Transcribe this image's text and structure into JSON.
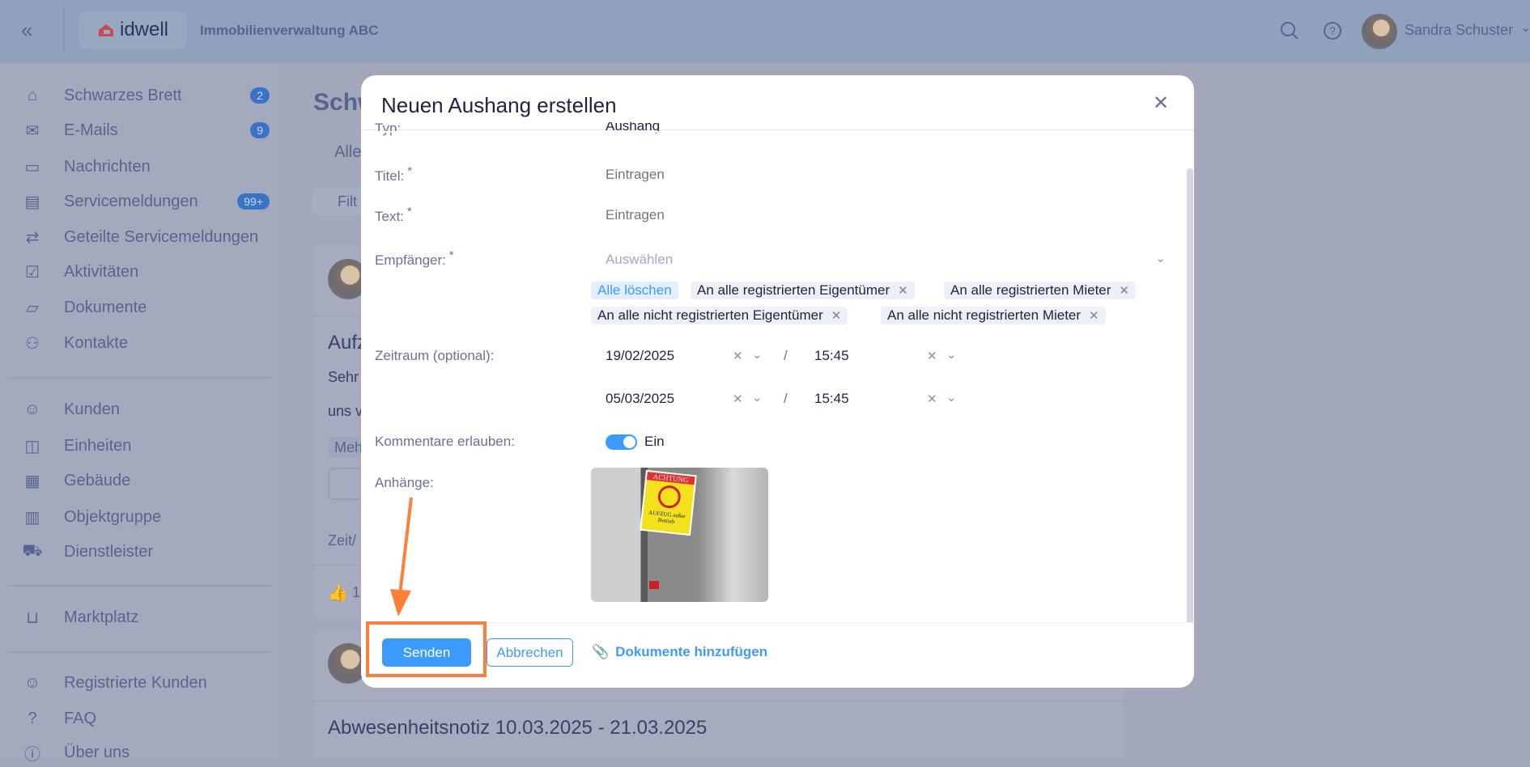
{
  "header": {
    "org_name": "Immobilienverwaltung ABC",
    "logo_text": "idwell",
    "user_name": "Sandra Schuster"
  },
  "sidebar": {
    "items": [
      {
        "label": "Schwarzes Brett",
        "badge": "2"
      },
      {
        "label": "E-Mails",
        "badge": "9"
      },
      {
        "label": "Nachrichten"
      },
      {
        "label": "Servicemeldungen",
        "badge": "99+"
      },
      {
        "label": "Geteilte Servicemeldungen"
      },
      {
        "label": "Aktivitäten"
      },
      {
        "label": "Dokumente"
      },
      {
        "label": "Kontakte"
      },
      {
        "label": "Kunden"
      },
      {
        "label": "Einheiten"
      },
      {
        "label": "Gebäude"
      },
      {
        "label": "Objektgruppe"
      },
      {
        "label": "Dienstleister"
      },
      {
        "label": "Marktplatz"
      },
      {
        "label": "Registrierte Kunden"
      },
      {
        "label": "FAQ"
      },
      {
        "label": "Über uns"
      }
    ]
  },
  "background": {
    "page_title": "Schw",
    "tab": "Alle",
    "filter": "Filt",
    "post_title": "Aufz",
    "post_line1": "Sehr",
    "post_line2": "uns v",
    "more_tag": "Meh",
    "time_label": "Zeit/",
    "likes": "1",
    "post2_title": "Abwesenheitsnotiz 10.03.2025 - 21.03.2025"
  },
  "modal": {
    "title": "Neuen Aushang erstellen",
    "typ_label": "Typ:",
    "typ_value": "Aushang",
    "titel_label": "Titel:",
    "titel_placeholder": "Eintragen",
    "text_label": "Text:",
    "text_placeholder": "Eintragen",
    "required_mark": "*",
    "empfaenger_label": "Empfänger:",
    "empfaenger_placeholder": "Auswählen",
    "clear_all": "Alle löschen",
    "recipients": [
      "An alle registrierten Eigentümer",
      "An alle registrierten Mieter",
      "An alle nicht registrierten Eigentümer",
      "An alle nicht registrierten Mieter"
    ],
    "zeitraum_label": "Zeitraum (optional):",
    "start_date": "19/02/2025",
    "start_time": "15:45",
    "end_date": "05/03/2025",
    "end_time": "15:45",
    "separator": "/",
    "kommentare_label": "Kommentare erlauben:",
    "kommentare_value": "Ein",
    "kommentare_on": true,
    "anhaenge_label": "Anhänge:",
    "attachment_sign": {
      "top": "ACHTUNG",
      "bottom": "AUFZUG außer Betrieb"
    },
    "send_label": "Senden",
    "cancel_label": "Abbrechen",
    "add_docs_label": "Dokumente hinzufügen"
  },
  "colors": {
    "primary": "#3d9bff",
    "highlight": "#ff7f3a"
  }
}
